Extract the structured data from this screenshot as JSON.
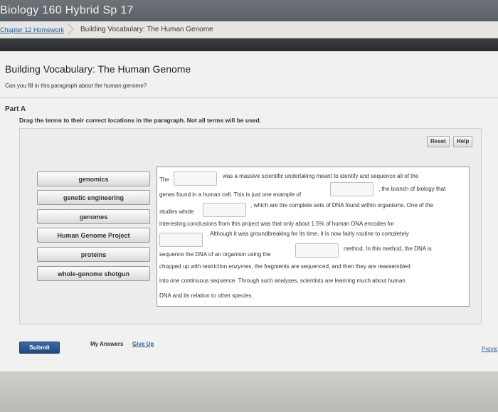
{
  "course": {
    "title": "Biology 160 Hybrid Sp 17"
  },
  "breadcrumb": {
    "parent": "Chapter 12 Homework",
    "current": "Building Vocabulary: The Human Genome"
  },
  "question": {
    "title": "Building Vocabulary: The Human Genome",
    "prompt": "Can you fill in this paragraph about the human genome?"
  },
  "part": {
    "label": "Part A",
    "instructions": "Drag the terms to their correct locations in the paragraph. Not all terms will be used."
  },
  "toolbar": {
    "reset_label": "Reset",
    "help_label": "Help"
  },
  "terms": [
    "genomics",
    "genetic engineering",
    "genomes",
    "Human Genome Project",
    "proteins",
    "whole-genome shotgun"
  ],
  "paragraph": {
    "t1": "The",
    "t2": "was a massive scientific undertaking meant to identify and sequence all of the",
    "t3": "genes found in a human cell. This is just one example of",
    "t4": ", the branch of biology that",
    "t5": "studies whole",
    "t6": ", which are the complete sets of DNA found within organisms. One of the",
    "t7": "interesting conclusions from this project was that only about 1.5% of human DNA encodes for",
    "t8": ". Although it was groundbreaking for its time, it is now fairly routine to completely",
    "t9": "sequence the DNA of an organism using the",
    "t10": "method. In this method, the DNA is",
    "t11": "chopped up with restriction enzymes, the fragments are sequenced, and then they are reassembled",
    "t12": "into one continuous sequence. Through such analyses, scientists are learning much about human",
    "t13": "DNA and its relation to other species."
  },
  "footer": {
    "submit_label": "Submit",
    "my_answers_label": "My Answers",
    "give_up_label": "Give Up",
    "provide_label": "Provic"
  },
  "colors": {
    "link": "#2a5d9c",
    "submit": "#2f5a93",
    "header": "#646a70"
  }
}
